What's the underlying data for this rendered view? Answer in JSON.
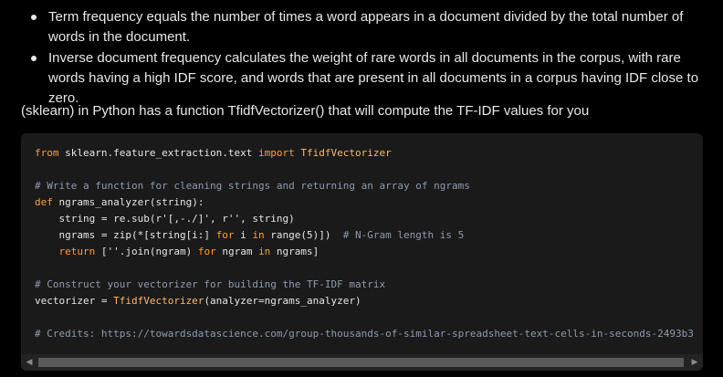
{
  "bullets": [
    "Term frequency equals the number of times a word appears in a document divided by the total number of words in the document.",
    "Inverse document frequency calculates the weight of rare words in all documents in the corpus, with rare words having a high IDF score, and words that are present in all documents in a corpus having IDF close to zero."
  ],
  "intro": "(sklearn) in Python has a function TfidfVectorizer() that will compute the TF-IDF values for you",
  "code": {
    "l1_from": "from",
    "l1_mod": " sklearn.feature_extraction.text ",
    "l1_import": "import",
    "l1_class": " TfidfVectorizer",
    "l3_comment": "# Write a function for cleaning strings and returning an array of ngrams",
    "l4_def": "def",
    "l4_rest": " ngrams_analyzer(string):",
    "l5": "    string = re.sub(r'[,-./]', r'', string)",
    "l6_a": "    ngrams = zip(*[string[i:] ",
    "l6_for": "for",
    "l6_b": " i ",
    "l6_in": "in",
    "l6_c": " range(5)])  ",
    "l6_comment": "# N-Gram length is 5",
    "l7_return": "    return",
    "l7_a": " [''.join(ngram) ",
    "l7_for": "for",
    "l7_b": " ngram ",
    "l7_in": "in",
    "l7_c": " ngrams]",
    "l9_comment": "# Construct your vectorizer for building the TF-IDF matrix",
    "l10_a": "vectorizer = ",
    "l10_class": "TfidfVectorizer",
    "l10_b": "(analyzer=ngrams_analyzer)",
    "l12_comment": "# Credits: https://towardsdatascience.com/group-thousands-of-similar-spreadsheet-text-cells-in-seconds-2493b3"
  },
  "scrollbar": {
    "left_arrow": "◀",
    "right_arrow": "▶",
    "position": 0.0
  },
  "colors": {
    "keyword": "#ff9e3b",
    "comment": "#8d9bb0",
    "code_bg": "#1a1a1a"
  }
}
